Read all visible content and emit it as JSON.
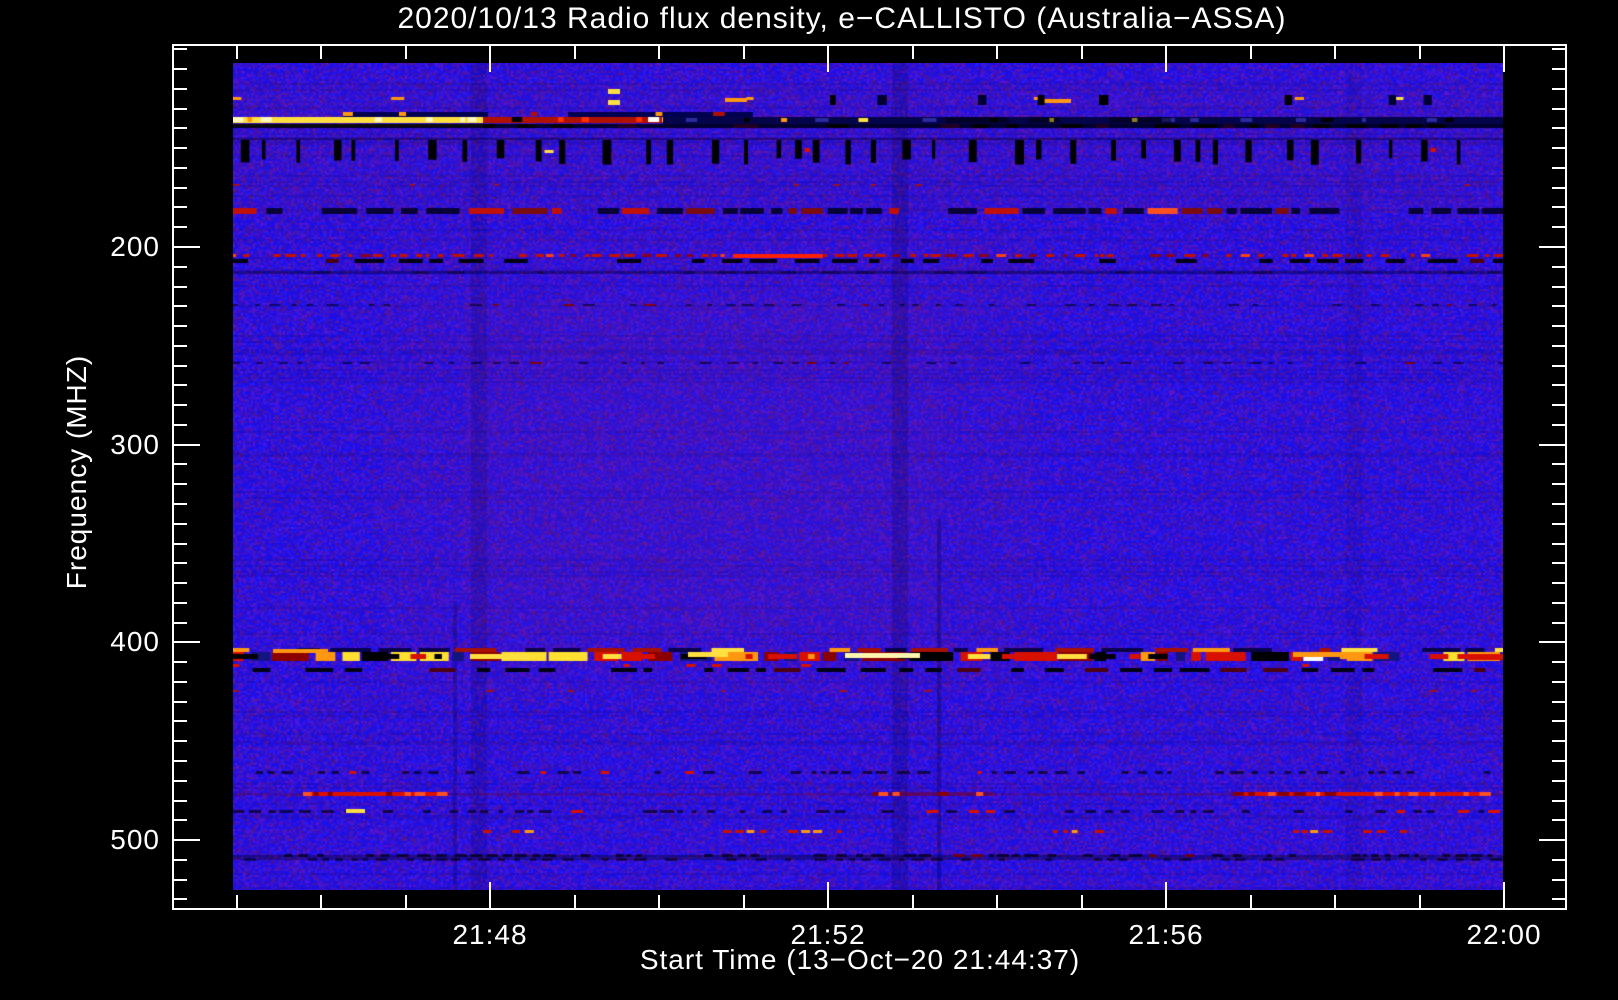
{
  "title": "2020/10/13  Radio flux density, e−CALLISTO (Australia−ASSA)",
  "axes": {
    "x_title": "Start Time (13−Oct−20 21:44:37)",
    "y_title": "Frequency (MHZ)",
    "x_ticks": [
      {
        "label": "21:48",
        "min": 4
      },
      {
        "label": "21:52",
        "min": 8
      },
      {
        "label": "21:56",
        "min": 12
      },
      {
        "label": "22:00",
        "min": 16
      }
    ],
    "x_minor_step_min": 1,
    "y_ticks": [
      200,
      300,
      400,
      500
    ],
    "y_minor_step_mhz": 10
  },
  "chart_data": {
    "type": "heatmap",
    "title": "2020/10/13  Radio flux density, e−CALLISTO (Australia−ASSA)",
    "xlabel": "Start Time (13−Oct−20 21:44:37)",
    "ylabel": "Frequency (MHZ)",
    "date": "2020/10/13",
    "instrument": "e-CALLISTO",
    "station": "Australia-ASSA",
    "start_time": "21:44:37",
    "x_tick_labels": [
      "21:48",
      "21:52",
      "21:56",
      "22:00"
    ],
    "y_tick_labels": [
      200,
      300,
      400,
      500
    ],
    "y_axis_inverted": true,
    "freq_range_mhz": [
      97,
      535
    ],
    "time_range": [
      "21:44:37",
      "22:00:00"
    ],
    "grid": false,
    "legend": false,
    "colormap": "blue background (quiet), purple speckle noise, red/orange/yellow/white strong RFI, black dropouts",
    "features": [
      {
        "kind": "sparse_orange",
        "f": 128,
        "desc": "scattered orange dashes near top"
      },
      {
        "kind": "black_blocks",
        "f": 129,
        "desc": "short black dropout blocks, right half"
      },
      {
        "kind": "carrier_band",
        "f": 136,
        "desc": "strong carrier: yellow-white line on left, dark band with orange dashes on right"
      },
      {
        "kind": "barcode",
        "f": 151,
        "desc": "periodic black vertical dropout bars"
      },
      {
        "kind": "mixed_band",
        "f": 182,
        "desc": "dark band with red RFI segments"
      },
      {
        "kind": "red_dotted",
        "f": 204,
        "desc": "red dotted interference line"
      },
      {
        "kind": "black_dashed",
        "f": 206,
        "desc": "black dashed line"
      },
      {
        "kind": "faint_dark",
        "f": 212,
        "desc": "faint dark band"
      },
      {
        "kind": "faint_dark_dotted",
        "f": 229,
        "desc": "faint dark dotted line"
      },
      {
        "kind": "faint_dark_dotted",
        "f": 258,
        "desc": "faint dark dotted line"
      },
      {
        "kind": "rfi_band",
        "f": 407,
        "desc": "major RFI band: red/orange/yellow/white/black segments"
      },
      {
        "kind": "black_dashed",
        "f": 413,
        "desc": "black dashed line under RFI band"
      },
      {
        "kind": "dark_dotted",
        "f": 465,
        "redp": 0.12,
        "desc": "dark dotted line with red specks"
      },
      {
        "kind": "red_streaks",
        "f": 476,
        "segs": [
          [
            70,
            215
          ],
          [
            640,
            760
          ],
          [
            1000,
            1257
          ]
        ],
        "desc": "red streak segments"
      },
      {
        "kind": "dark_dotted",
        "f": 485,
        "redp": 0.08,
        "yellow_at": [
          113,
          132
        ],
        "desc": "dark dotted line, one yellow dash"
      },
      {
        "kind": "sparse_red",
        "f": 495,
        "segs": [
          [
            250,
            300
          ],
          [
            490,
            535
          ],
          [
            555,
            605
          ],
          [
            820,
            870
          ],
          [
            1060,
            1095
          ],
          [
            1130,
            1175
          ]
        ],
        "desc": "sparse red dashes"
      },
      {
        "kind": "dark_dotted_band",
        "f": 508,
        "desc": "dark dotted band near bottom"
      }
    ],
    "vertical_artifacts": [
      {
        "x_frac": 0.175,
        "from_frac": 0.82,
        "strength": 0.22,
        "desc": "dark column, lower part"
      },
      {
        "x_frac": 0.194,
        "from_frac": 0.0,
        "strength": 0.14,
        "desc": "faint dark column"
      },
      {
        "x_frac": 0.525,
        "from_frac": 0.0,
        "strength": 0.18,
        "desc": "dark column"
      },
      {
        "x_frac": 0.556,
        "from_frac": 0.72,
        "strength": 0.28,
        "desc": "thin dark column, lower part"
      },
      {
        "x_frac": 0.883,
        "from_frac": 0.0,
        "strength": 0.07,
        "desc": "very faint dark column"
      }
    ]
  },
  "colors": {
    "background": "#000000",
    "axis": "#ffffff",
    "quiet_blue": "#1d0fe4",
    "bright_blue": "#2f1fff",
    "purple_noise": "#5a17a0",
    "maroon_noise": "#701646",
    "rfi_red": "#d81000",
    "rfi_dark_red": "#8a0000",
    "rfi_orange": "#ff9810",
    "rfi_yellow": "#ffe040",
    "rfi_white": "#ffffff",
    "dropout_black": "#000000"
  }
}
